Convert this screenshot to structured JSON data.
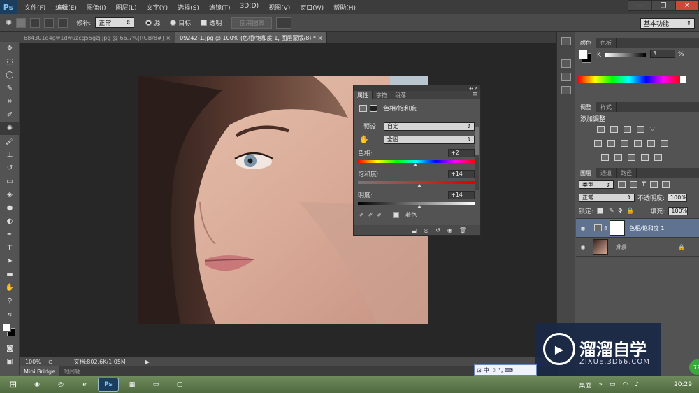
{
  "app": {
    "logo": "Ps"
  },
  "menu": [
    "文件(F)",
    "编辑(E)",
    "图像(I)",
    "图层(L)",
    "文字(Y)",
    "选择(S)",
    "滤镜(T)",
    "3D(D)",
    "视图(V)",
    "窗口(W)",
    "帮助(H)"
  ],
  "window_controls": {
    "minimize": "—",
    "restore": "❐",
    "close": "✕"
  },
  "options": {
    "repair_label": "修补:",
    "repair_value": "正常",
    "source_label": "源",
    "target_label": "目标",
    "transparent_label": "透明",
    "use_pattern": "使用图案",
    "workspace": "基本功能"
  },
  "doc_tabs": [
    {
      "label": "684301d4gw1dwuzcg55gzj.jpg @ 66.7%(RGB/8#)",
      "close": "×"
    },
    {
      "label": "09242-1.jpg @ 100% (色相/饱和度 1, 图层蒙版/8) *",
      "close": "×"
    }
  ],
  "status": {
    "zoom": "100%",
    "doc": "文档:802.6K/1.05M"
  },
  "bottom_tabs": [
    "Mini Bridge",
    "时间轴"
  ],
  "properties": {
    "tabs": [
      "属性",
      "字符",
      "段落"
    ],
    "title": "色相/饱和度",
    "preset_label": "预设:",
    "preset_value": "自定",
    "channel_value": "全图",
    "hue_label": "色相:",
    "hue_value": "+2",
    "hue_pct": 0.51,
    "sat_label": "饱和度:",
    "sat_value": "+14",
    "sat_pct": 0.55,
    "light_label": "明度:",
    "light_value": "+14",
    "light_pct": 0.55,
    "colorize_label": "着色"
  },
  "color_panel": {
    "tabs": [
      "颜色",
      "色板"
    ],
    "k_label": "K",
    "k_value": "3",
    "pct": "%"
  },
  "adjust_panel": {
    "tabs": [
      "调整",
      "样式"
    ],
    "title": "添加调整"
  },
  "layers_panel": {
    "tabs": [
      "图层",
      "通道",
      "路径"
    ],
    "kind": "类型",
    "blend": "正常",
    "opacity_label": "不透明度:",
    "opacity_value": "100%",
    "lock_label": "锁定:",
    "fill_label": "填充:",
    "fill_value": "100%",
    "layers": [
      {
        "name": "色相/饱和度 1"
      },
      {
        "name": "背景"
      }
    ]
  },
  "watermark": {
    "brand": "溜溜自学",
    "url": "ZIXUE.3D66.COM"
  },
  "ime": {
    "lang": "中"
  },
  "taskbar": {
    "desktop": "桌面",
    "time": "20:29",
    "badge": "72"
  },
  "colors": {
    "accent": "#3a6ea5",
    "ps_blue": "#7fc0f0",
    "dark": "#272727"
  }
}
